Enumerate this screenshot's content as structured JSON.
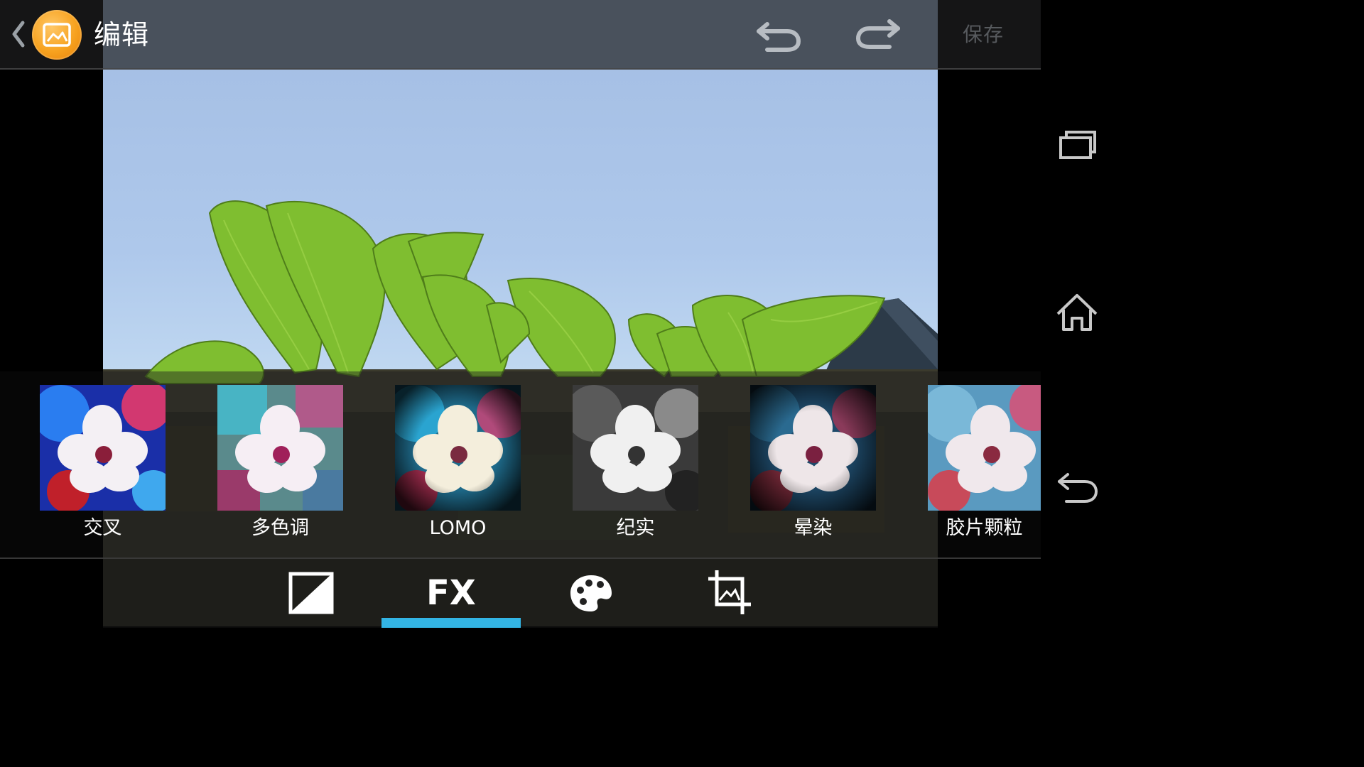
{
  "action_bar": {
    "title": "编辑",
    "save_label": "保存",
    "icons": {
      "back": "chevron-left-icon",
      "app": "gallery-photo-icon",
      "undo": "undo-icon",
      "redo": "redo-icon"
    }
  },
  "filters": [
    {
      "label": "交叉",
      "style": "cross-process"
    },
    {
      "label": "多色调",
      "style": "posterize"
    },
    {
      "label": "LOMO",
      "style": "lomo"
    },
    {
      "label": "纪实",
      "style": "documentary"
    },
    {
      "label": "晕染",
      "style": "vignette"
    },
    {
      "label": "胶片颗粒",
      "style": "film-grain"
    }
  ],
  "toolbar": {
    "fx_label": "FX",
    "tools": [
      "exposure-icon",
      "fx-icon",
      "palette-icon",
      "crop-icon"
    ],
    "active_tool": "fx",
    "accent": "#33b5e5"
  },
  "nav_bar": {
    "buttons": [
      "recent-apps-icon",
      "home-icon",
      "back-icon"
    ]
  },
  "colors": {
    "accent": "#33b5e5",
    "app_icon": "#f7a21f",
    "sky": "#b4cdee",
    "leaf": "#7fbf2e"
  }
}
